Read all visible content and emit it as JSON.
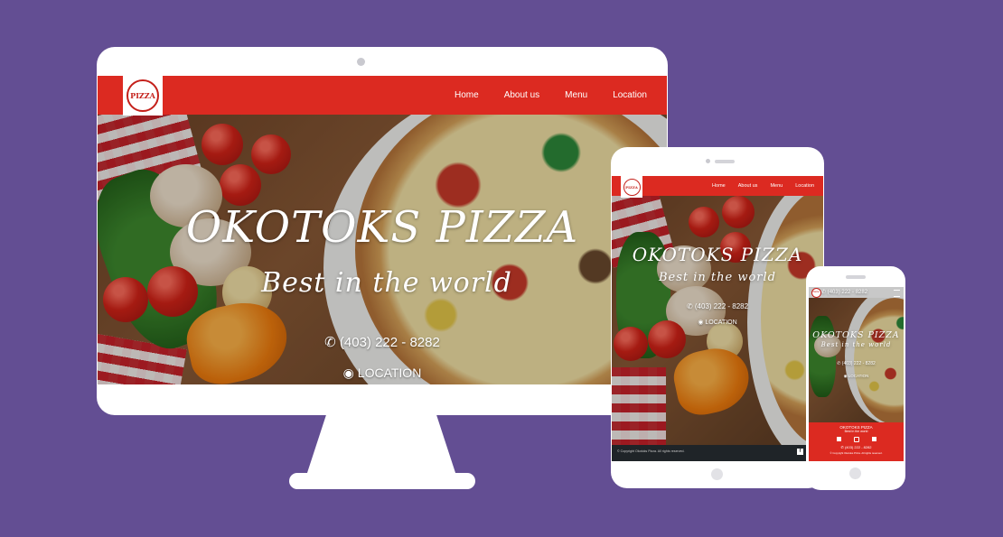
{
  "brand": {
    "logo_text": "PIZZA",
    "name": "OKOTOKS PIZZA",
    "tagline": "Best in the world",
    "phone_icon": "phone-icon",
    "phone": "(403) 222 - 8282",
    "location_icon": "map-pin-icon",
    "location": "LOCATION"
  },
  "nav": {
    "items": [
      "Home",
      "About us",
      "Menu",
      "Location"
    ]
  },
  "footer": {
    "copyright": "© Copyright Okotoks Pizza. All rights reserved.",
    "social_icons": [
      "facebook-icon",
      "instagram-icon",
      "twitter-icon"
    ]
  },
  "colors": {
    "background": "#634e93",
    "brand_red": "#dc2a21",
    "footer_dark": "#1f2428"
  }
}
